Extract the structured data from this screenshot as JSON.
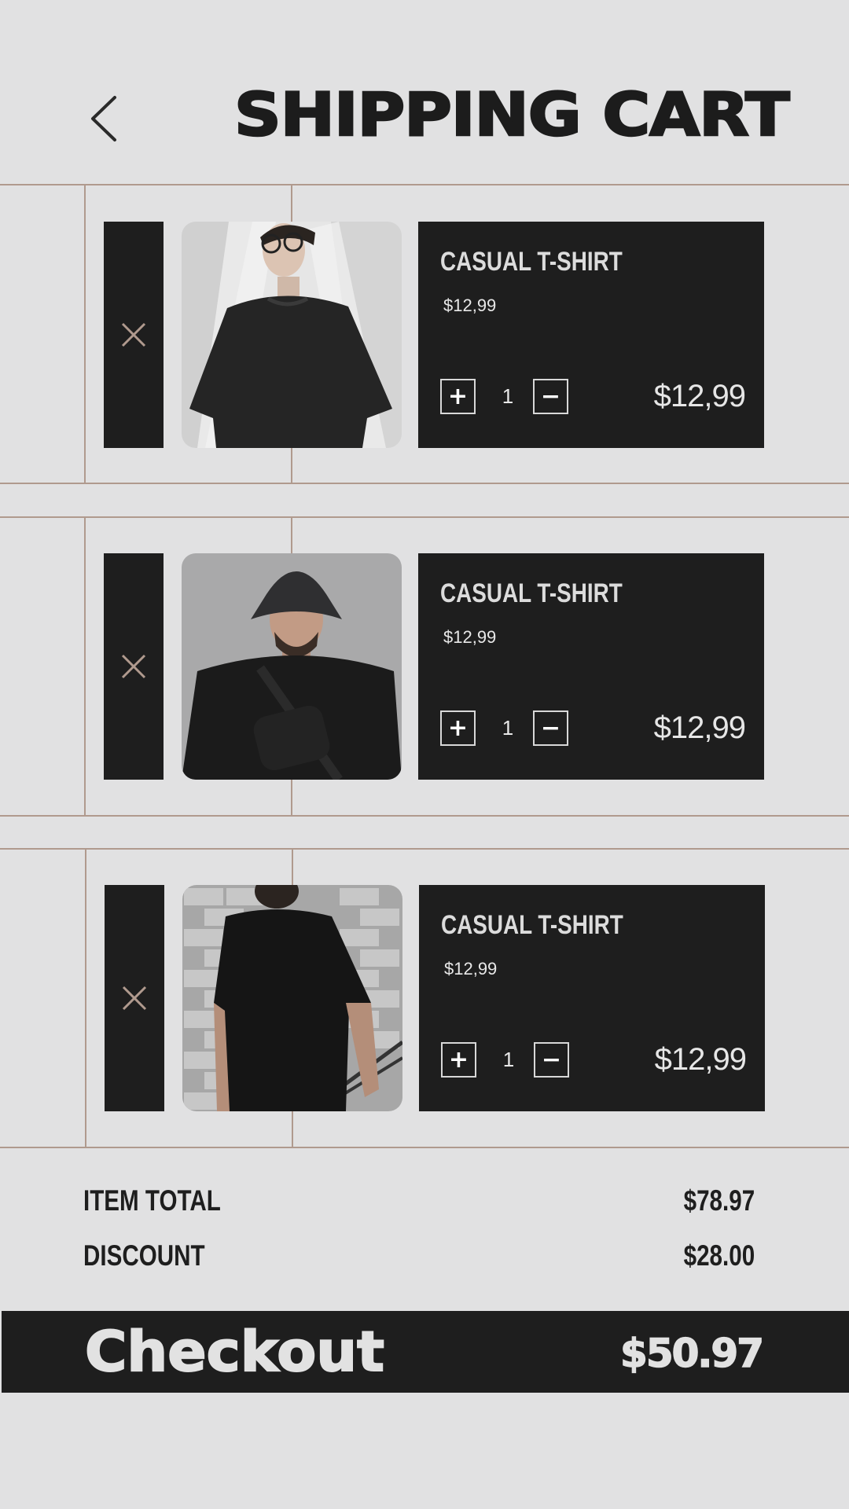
{
  "header": {
    "title": "SHIPPING CART",
    "back_icon": "chevron-left-icon"
  },
  "cart": {
    "items": [
      {
        "name": "CASUAL T-SHIRT",
        "unit_price": "$12,99",
        "quantity": "1",
        "line_total": "$12,99",
        "plus": "+",
        "minus": "−",
        "image": "model-with-glasses-black-tshirt"
      },
      {
        "name": "CASUAL T-SHIRT",
        "unit_price": "$12,99",
        "quantity": "1",
        "line_total": "$12,99",
        "plus": "+",
        "minus": "−",
        "image": "model-with-bucket-hat-black-tshirt"
      },
      {
        "name": "CASUAL T-SHIRT",
        "unit_price": "$12,99",
        "quantity": "1",
        "line_total": "$12,99",
        "plus": "+",
        "minus": "−",
        "image": "model-back-view-black-tshirt-brick-wall"
      }
    ]
  },
  "summary": {
    "item_total_label": "ITEM TOTAL",
    "item_total_value": "$78.97",
    "discount_label": "DISCOUNT",
    "discount_value": "$28.00"
  },
  "checkout": {
    "label": "Checkout",
    "total": "$50.97"
  },
  "colors": {
    "background": "#e1e1e2",
    "dark": "#1e1e1e",
    "accent": "#b09a8e",
    "text_light": "#e2e2e2"
  }
}
